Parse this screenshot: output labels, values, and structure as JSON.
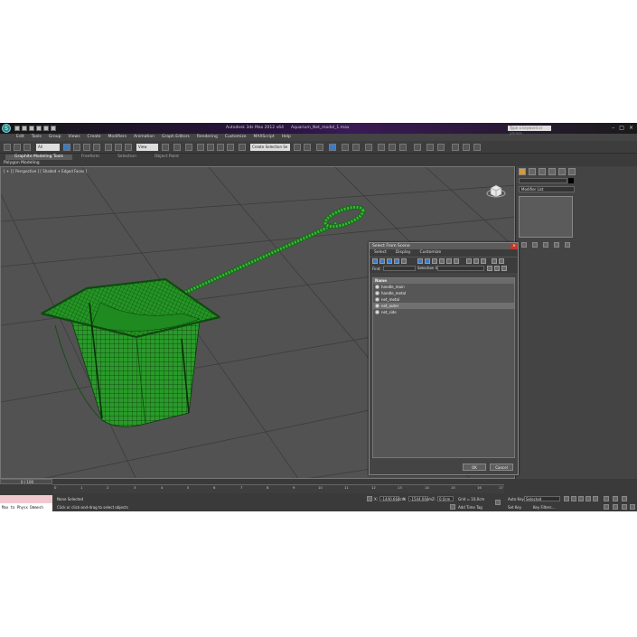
{
  "titlebar": {
    "app": "Autodesk 3ds Max  2012 x64",
    "file": "Aquarium_Net_model_1.max",
    "search_placeholder": "Type a keyword or phrase"
  },
  "menu": [
    "Edit",
    "Tools",
    "Group",
    "Views",
    "Create",
    "Modifiers",
    "Animation",
    "Graph Editors",
    "Rendering",
    "Customize",
    "MAXScript",
    "Help"
  ],
  "toolbar": {
    "selection_filter": "All",
    "reference_coord": "View",
    "named_selection": "Create Selection Se"
  },
  "ribbon": {
    "tabs": [
      "Graphite Modeling Tools",
      "Freeform",
      "Selection",
      "Object Paint"
    ],
    "sub_label": "Polygon Modeling"
  },
  "viewport": {
    "label": "[ + ] [ Perspective ] [ Shaded + Edged Faces ]"
  },
  "command_panel": {
    "modifier_list": "Modifier List"
  },
  "dialog": {
    "title": "Select From Scene",
    "menu": [
      "Select",
      "Display",
      "Customize"
    ],
    "find_label": "Find:",
    "selection_sets_label": "Selection Set:",
    "column_name": "Name",
    "objects": [
      {
        "name": "handle_main",
        "selected": false
      },
      {
        "name": "handle_metal",
        "selected": false
      },
      {
        "name": "net_metal",
        "selected": false
      },
      {
        "name": "net_outer",
        "selected": true
      },
      {
        "name": "net_side",
        "selected": false
      }
    ],
    "ok_label": "OK",
    "cancel_label": "Cancel"
  },
  "timeline": {
    "frame_display": "0 / 100",
    "ticks": [
      "0",
      "1",
      "2",
      "3",
      "4",
      "5",
      "6",
      "7",
      "8",
      "9",
      "10",
      "11",
      "12",
      "13",
      "14",
      "15",
      "16",
      "17"
    ]
  },
  "statusbar": {
    "maxscript_text": "Max to Physx Dmmesh",
    "status_line": "None Selected",
    "prompt_line": "Click or click-and-drag to select objects",
    "x_value": "-1440.664cm",
    "y_value": "-1544.00cm",
    "z_value": "0.0cm",
    "grid": "Grid = 10,0cm",
    "auto_key": "Auto Key",
    "auto_key_value": "Selected",
    "set_key": "Set Key",
    "key_filters": "Key Filters...",
    "add_time_tag": "Add Time Tag"
  },
  "colors": {
    "mesh": "#2fa82f",
    "viewport_bg": "#525252",
    "accent": "#3a7bc8",
    "close": "#c0392b"
  }
}
